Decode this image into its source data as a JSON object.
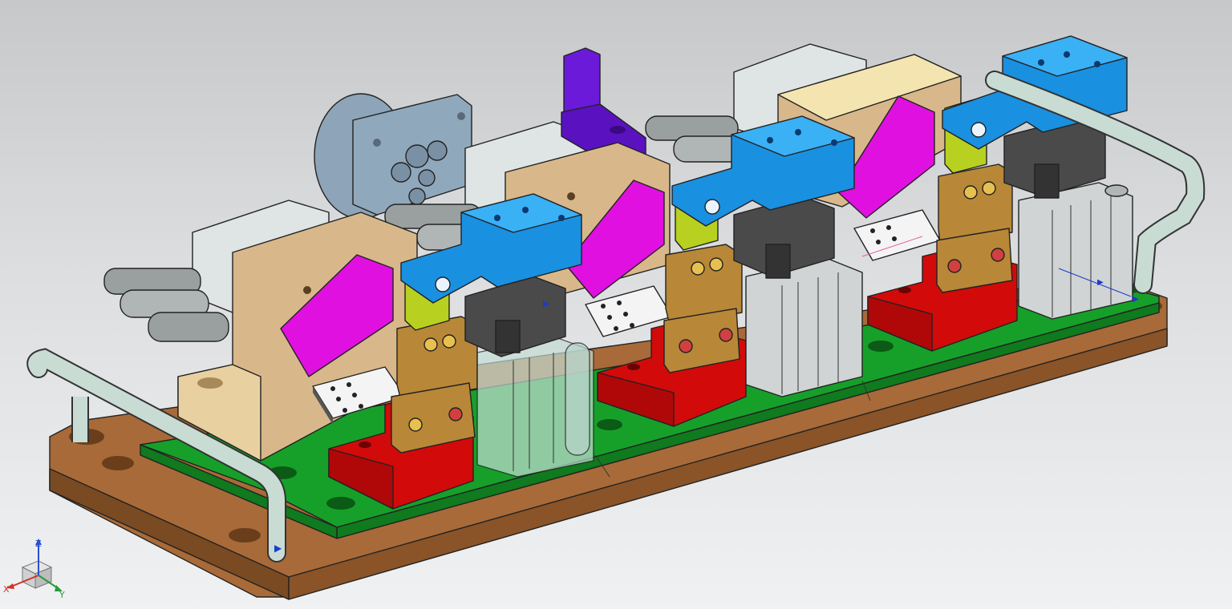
{
  "viewport": {
    "background_top": "#c6c8ca",
    "background_bottom": "#f0f1f2"
  },
  "triad": {
    "x_label": "X",
    "y_label": "Y",
    "z_label": "Z",
    "x_color": "#d0302a",
    "y_color": "#2a9a3a",
    "z_color": "#2a4fd0"
  },
  "colors": {
    "base_plate": "#a86a38",
    "green_plate": "#15a02a",
    "red_block": "#d20a0a",
    "tan_block": "#d8b88a",
    "magenta_wedge": "#e010e0",
    "blue_clamp": "#1a90e0",
    "yellow_green_pivot": "#b8d020",
    "brass_part": "#b88838",
    "grey_cylinder": "#d0d4d4",
    "dark_grey_head": "#4a4a4a",
    "purple_bracket": "#6a1ad8",
    "handle": "#c8dcd4"
  }
}
